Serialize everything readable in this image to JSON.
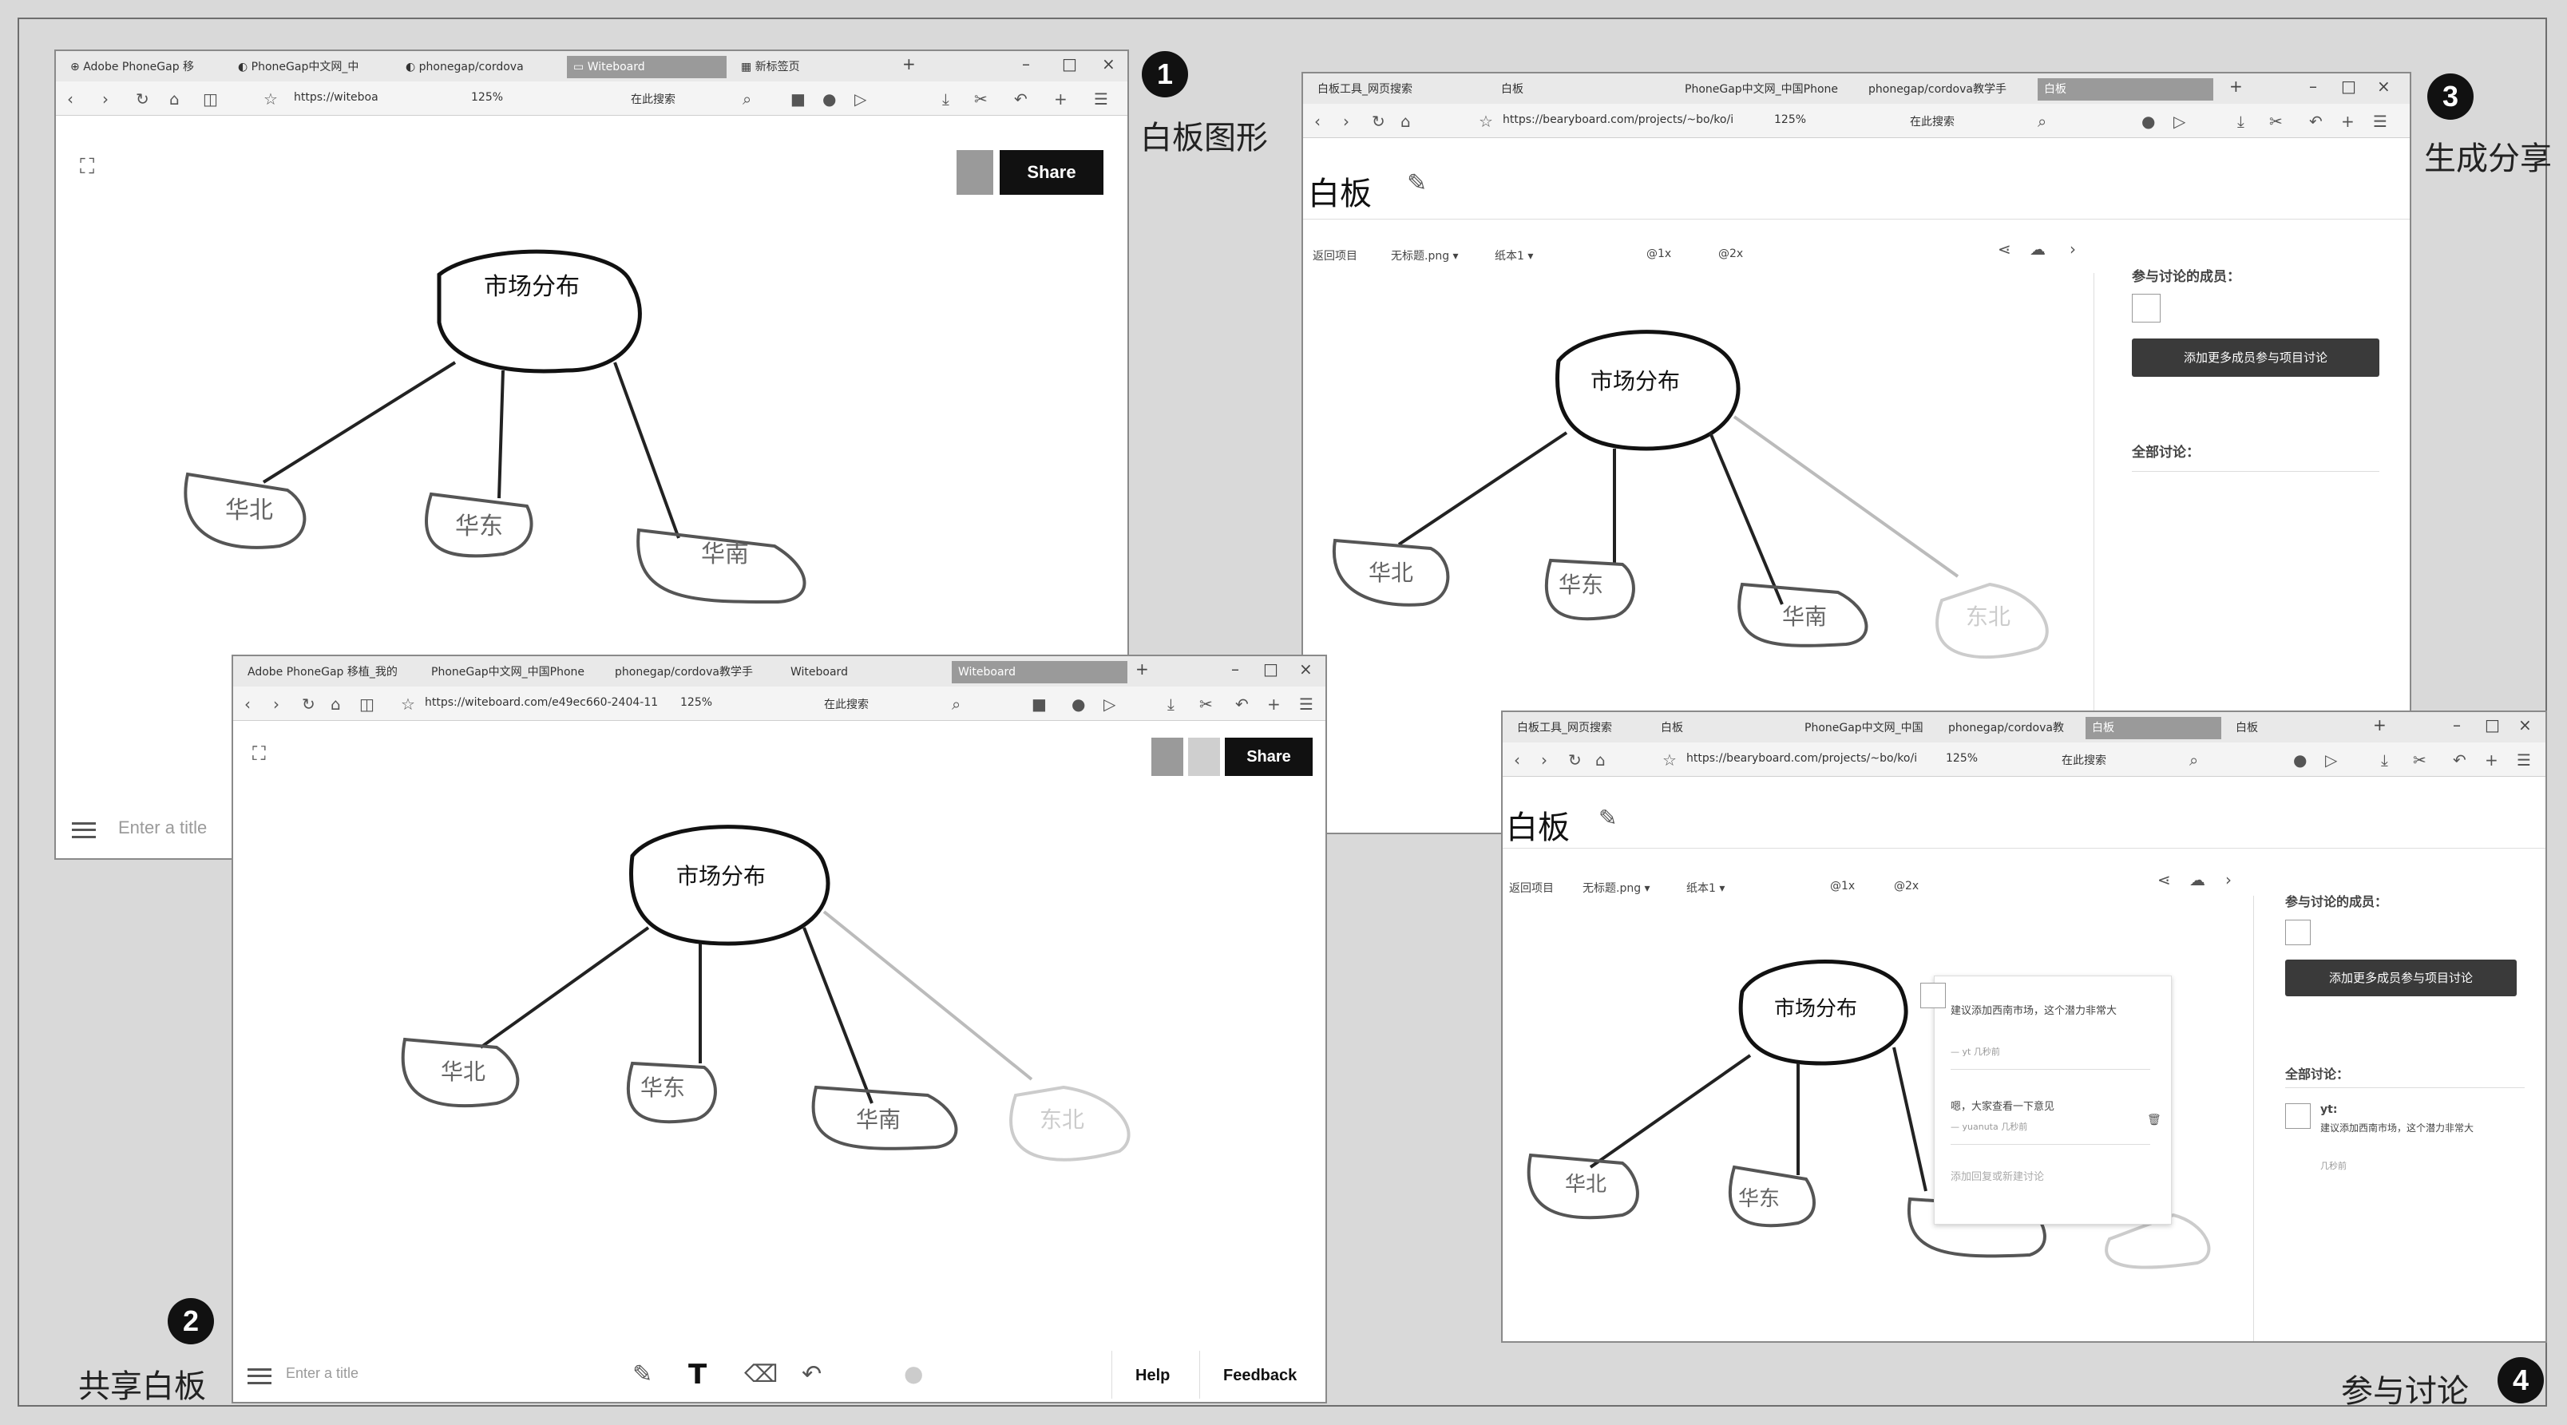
{
  "annotations": {
    "step1": {
      "num": "1",
      "label": "白板图形"
    },
    "step2": {
      "num": "2",
      "label": "共享白板"
    },
    "step3": {
      "num": "3",
      "label": "生成分享"
    },
    "step4": {
      "num": "4",
      "label": "参与讨论"
    }
  },
  "win1": {
    "tabs": [
      "Adobe PhoneGap 移",
      "PhoneGap中文网_中",
      "phonegap/cordova",
      "Witeboard",
      "新标签页"
    ],
    "url": "https://witeboa",
    "zoom": "125%",
    "search": "在此搜索",
    "share": "Share",
    "title_placeholder": "Enter a title"
  },
  "win2": {
    "tabs": [
      "Adobe PhoneGap 移植_我的",
      "PhoneGap中文网_中国Phone",
      "phonegap/cordova教学手",
      "Witeboard",
      "Witeboard"
    ],
    "url": "https://witeboard.com/e49ec660-2404-11",
    "zoom": "125%",
    "search": "在此搜索",
    "share": "Share",
    "title_placeholder": "Enter a title",
    "help": "Help",
    "feedback": "Feedback"
  },
  "win3": {
    "tabs": [
      "白板工具_网页搜索",
      "白板",
      "PhoneGap中文网_中国Phone",
      "phonegap/cordova教学手",
      "白板"
    ],
    "url": "https://bearyboard.com/projects/~bo/ko/i",
    "zoom": "125%",
    "search": "在此搜索",
    "page_title": "白板",
    "toolbar": {
      "back": "返回项目",
      "file": "无标题.png ▾",
      "paper": "纸本1 ▾",
      "x1": "@1x",
      "x2": "@2x"
    },
    "members_label": "参与讨论的成员：",
    "add_button": "添加更多成员参与项目讨论",
    "discussion_label": "全部讨论："
  },
  "win4": {
    "tabs": [
      "白板工具_网页搜索",
      "白板",
      "PhoneGap中文网_中国",
      "phonegap/cordova教",
      "白板",
      "白板"
    ],
    "url": "https://bearyboard.com/projects/~bo/ko/i",
    "zoom": "125%",
    "search": "在此搜索",
    "page_title": "白板",
    "toolbar": {
      "back": "返回项目",
      "file": "无标题.png ▾",
      "paper": "纸本1 ▾",
      "x1": "@1x",
      "x2": "@2x"
    },
    "members_label": "参与讨论的成员：",
    "add_button": "添加更多成员参与项目讨论",
    "discussion_label": "全部讨论：",
    "popup": {
      "comment1": "建议添加西南市场，这个潜力非常大",
      "comment1_meta": "— yt 几秒前",
      "comment2": "嗯，大家查看一下意见",
      "comment2_meta": "— yuanuta 几秒前",
      "reply_placeholder": "添加回复或新建讨论"
    },
    "sidebar_comment": {
      "user": "yt:",
      "text": "建议添加西南市场，这个潜力非常大",
      "time": "几秒前"
    }
  },
  "mindmap": {
    "center": "市场分布",
    "north": "华北",
    "east": "华东",
    "south": "华南",
    "northeast": "东北"
  }
}
